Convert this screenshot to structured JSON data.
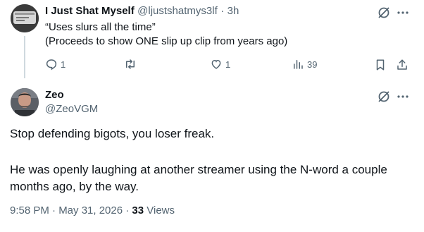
{
  "reply_tweet": {
    "display_name": "I Just Shat Myself",
    "handle": "@ljustshatmys3lf",
    "separator": "·",
    "time": "3h",
    "line1": "“Uses slurs all the time”",
    "line2": "(Proceeds to show ONE slip up clip from years ago)",
    "actions": {
      "reply_count": "1",
      "retweet_count": "",
      "like_count": "1",
      "views_count": "39"
    }
  },
  "main_tweet": {
    "display_name": "Zeo",
    "handle": "@ZeoVGM",
    "paragraph1": "Stop defending bigots, you loser freak.",
    "paragraph2_line1": "He was openly laughing at another streamer using the N-word a couple",
    "paragraph2_line2": "months ago, by the way.",
    "timestamp": "9:58 PM · May 31, 2026 · ",
    "views_count": "33",
    "views_label": " Views"
  },
  "icons": {
    "grok": "grok-icon",
    "more": "more-icon",
    "reply": "reply-icon",
    "retweet": "retweet-icon",
    "like": "heart-icon",
    "views": "views-icon",
    "bookmark": "bookmark-icon",
    "share": "share-icon"
  },
  "colors": {
    "text_primary": "#0f1419",
    "text_secondary": "#536471",
    "thread_line": "#cfd9de",
    "background": "#ffffff"
  }
}
